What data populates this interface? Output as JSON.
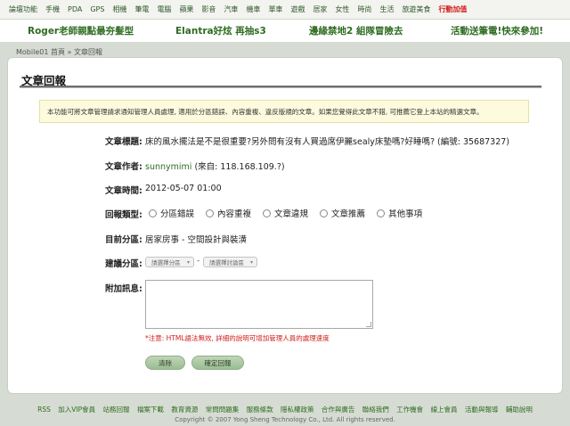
{
  "topnav": {
    "items": [
      "論壇功能",
      "手機",
      "PDA",
      "GPS",
      "相機",
      "筆電",
      "電腦",
      "蘋果",
      "影音",
      "汽車",
      "機車",
      "單車",
      "遊戲",
      "居家",
      "女性",
      "時尚",
      "生活",
      "旅遊美食"
    ],
    "hot": "行動加值"
  },
  "promo": {
    "items": [
      "Roger老師親點最夯髮型",
      "Elantra好炫 再抽s3",
      "邊緣禁地2 組隊冒險去",
      "活動送筆電!快來參加!"
    ]
  },
  "breadcrumb": {
    "home": "Mobile01 首頁",
    "sep": "»",
    "current": "文章回報"
  },
  "page": {
    "title": "文章回報",
    "notice": "本功能可將文章管理請求通知管理人員處理, 適用於分區錯誤、內容重複、違反版規的文章。如果您覺得此文章不錯, 可推薦它登上本站的精選文章。"
  },
  "form": {
    "article_title_label": "文章標題:",
    "article_title": "床的風水擺法是不是很重要?另外問有沒有人買過席伊麗sealy床墊嗎?好睡嗎? (編號: 35687327)",
    "author_label": "文章作者:",
    "author_name": "sunnymimi",
    "author_ip": " (來自: 118.168.109.?)",
    "time_label": "文章時間:",
    "time": "2012-05-07 01:00",
    "type_label": "回報類型:",
    "type_options": [
      "分區錯誤",
      "內容重複",
      "文章違規",
      "文章推薦",
      "其他事項"
    ],
    "category_label": "目前分區:",
    "category": "居家房事 - 空間設計與裝潢",
    "suggest_label": "建議分區:",
    "select_category_placeholder": "請選擇分區",
    "select_forum_placeholder": "請選擇討論區",
    "select_sep": "-",
    "message_label": "附加訊息:",
    "warning": "*注意: HTML語法無效, 詳細的說明可增加管理人員的處理速度",
    "clear_button": "清除",
    "submit_button": "確定回報"
  },
  "footer": {
    "links": [
      "RSS",
      "加入VIP會員",
      "站務回報",
      "檔案下載",
      "教育資源",
      "常問問題集",
      "服務條款",
      "隱私權政策",
      "合作與廣告",
      "聯絡我們",
      "工作機會",
      "線上會員",
      "活動與報導",
      "輔助說明"
    ],
    "copyright": "Copyright © 2007 Yong Sheng Technology Co., Ltd. All rights reserved."
  }
}
